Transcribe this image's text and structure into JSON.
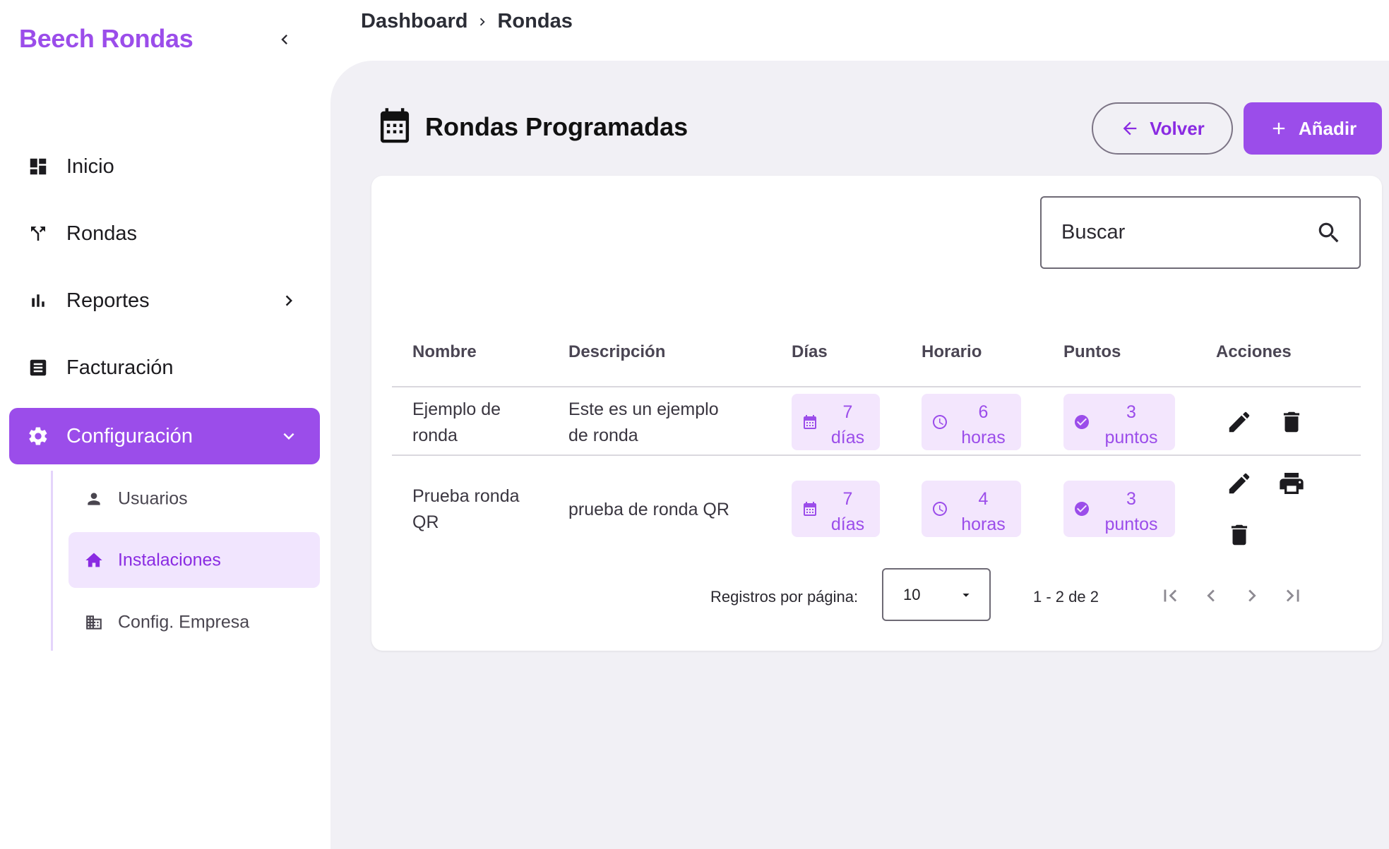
{
  "sidebar": {
    "brand": "Beech Rondas",
    "items": [
      {
        "label": "Inicio",
        "icon": "dashboard-icon"
      },
      {
        "label": "Rondas",
        "icon": "fork-icon"
      },
      {
        "label": "Reportes",
        "icon": "bar-chart-icon"
      },
      {
        "label": "Facturación",
        "icon": "receipt-icon"
      },
      {
        "label": "Configuración",
        "icon": "gear-icon"
      }
    ],
    "subitems": [
      {
        "label": "Usuarios",
        "icon": "person-icon"
      },
      {
        "label": "Instalaciones",
        "icon": "home-icon"
      },
      {
        "label": "Config. Empresa",
        "icon": "building-icon"
      }
    ]
  },
  "breadcrumb": {
    "root": "Dashboard",
    "current": "Rondas"
  },
  "page": {
    "title": "Rondas Programadas",
    "back_label": "Volver",
    "add_label": "Añadir"
  },
  "search": {
    "placeholder": "Buscar"
  },
  "table": {
    "headers": [
      "Nombre",
      "Descripción",
      "Días",
      "Horario",
      "Puntos",
      "Acciones"
    ],
    "rows": [
      {
        "name_l1": "Ejemplo de",
        "name_l2": "ronda",
        "desc_l1": "Este es un ejemplo",
        "desc_l2": "de ronda",
        "days_n": "7",
        "days_u": "días",
        "hours_n": "6",
        "hours_u": "horas",
        "points_n": "3",
        "points_u": "puntos"
      },
      {
        "name_l1": "Prueba ronda",
        "name_l2": "QR",
        "desc_l1": "prueba de ronda QR",
        "desc_l2": "",
        "days_n": "7",
        "days_u": "días",
        "hours_n": "4",
        "hours_u": "horas",
        "points_n": "3",
        "points_u": "puntos"
      }
    ]
  },
  "pagination": {
    "label": "Registros por página:",
    "page_size": "10",
    "range": "1 - 2 de 2"
  },
  "colors": {
    "accent": "#9b4dea",
    "accent_light": "#f3e6fd",
    "panel_bg": "#f1f0f5"
  }
}
